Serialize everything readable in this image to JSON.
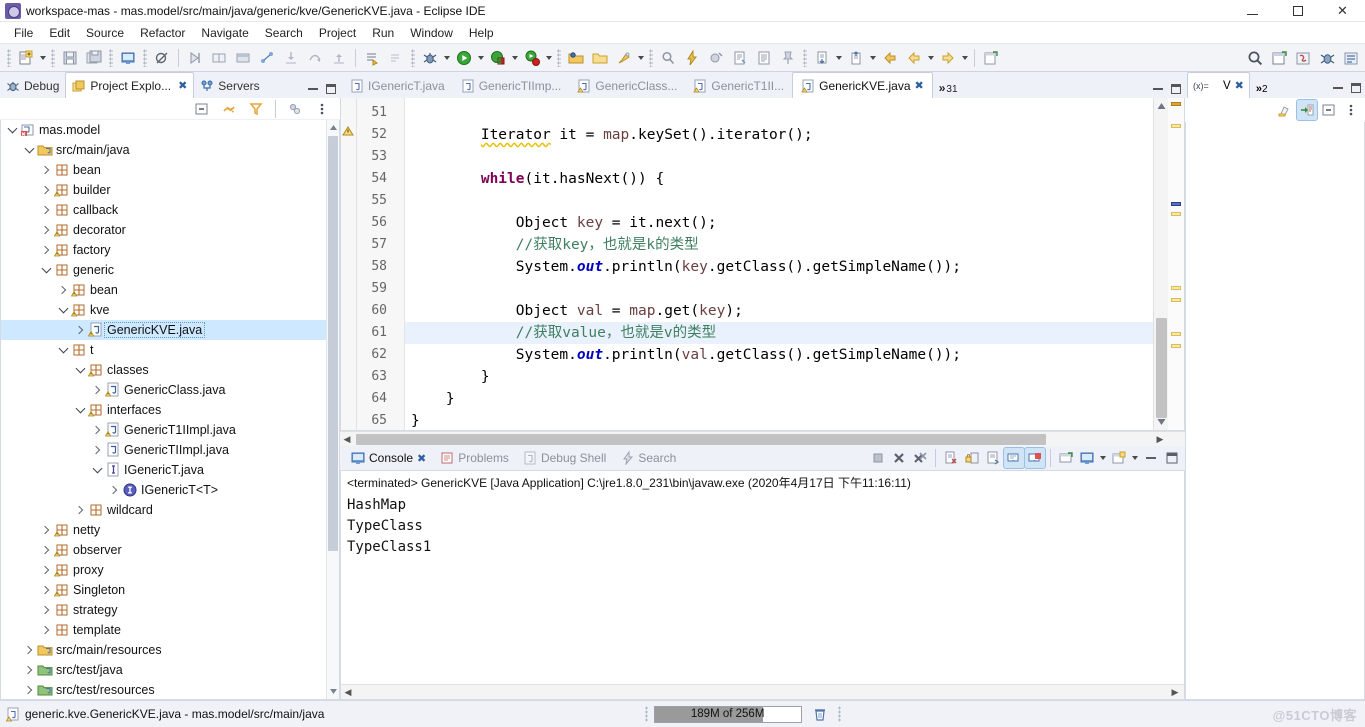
{
  "window": {
    "title": "workspace-mas - mas.model/src/main/java/generic/kve/GenericKVE.java - Eclipse IDE",
    "minimize_label": "–",
    "maximize_label": "❐",
    "close_label": "✕"
  },
  "menubar": {
    "items": [
      {
        "label": "File"
      },
      {
        "label": "Edit"
      },
      {
        "label": "Source"
      },
      {
        "label": "Refactor"
      },
      {
        "label": "Navigate"
      },
      {
        "label": "Search"
      },
      {
        "label": "Project"
      },
      {
        "label": "Run"
      },
      {
        "label": "Window"
      },
      {
        "label": "Help"
      }
    ]
  },
  "toolbar": {
    "icons": [
      "new-file-icon",
      "dropdown-arrow",
      "save-icon",
      "save-all-icon",
      "console-view-icon",
      "toggle-mark-occurrences-icon",
      "skip-breakpoints-icon",
      "new-window-icon",
      "toggle-view-icon",
      "link-icon",
      "step-icon",
      "step-alt-icon",
      "step-return-icon",
      "next-annotation-icon",
      "previous-annotation-icon",
      "debug-icon",
      "dropdown-arrow",
      "run-icon",
      "dropdown-arrow",
      "run-coverage-icon",
      "dropdown-arrow",
      "external-tools-icon",
      "dropdown-arrow",
      "new-java-project-icon",
      "open-folder-icon",
      "maven-build-icon",
      "dropdown-arrow",
      "search-refs-icon",
      "quick-access-icon",
      "new-class-icon",
      "open-type-icon",
      "open-task-icon",
      "pin-icon",
      "previous-edit-icon",
      "dropdown-arrow",
      "next-edit-icon",
      "dropdown-arrow",
      "back-icon",
      "forward-icon",
      "dropdown-arrow",
      "forward-alt-icon",
      "dropdown-arrow",
      "open-perspective-icon"
    ]
  },
  "left_panel": {
    "tabs": [
      {
        "label": "Debug",
        "icon": "debug-perspective-icon",
        "active": false,
        "closable": false
      },
      {
        "label": "Project Explo...",
        "icon": "project-explorer-icon",
        "active": true,
        "closable": true
      },
      {
        "label": "Servers",
        "icon": "servers-icon",
        "active": false,
        "closable": false
      }
    ],
    "toolbar_icons": [
      "collapse-all-icon",
      "link-with-editor-icon",
      "view-filter-icon",
      "view-layout-icon",
      "view-menu-icon"
    ],
    "tree": [
      {
        "label": "mas.model",
        "depth": 0,
        "twist": "open",
        "icon": "java-project-icon"
      },
      {
        "label": "src/main/java",
        "depth": 1,
        "twist": "open",
        "icon": "source-folder-icon"
      },
      {
        "label": "bean",
        "depth": 2,
        "twist": "closed",
        "icon": "package-icon"
      },
      {
        "label": "builder",
        "depth": 2,
        "twist": "closed",
        "icon": "package-warn-icon"
      },
      {
        "label": "callback",
        "depth": 2,
        "twist": "closed",
        "icon": "package-icon"
      },
      {
        "label": "decorator",
        "depth": 2,
        "twist": "closed",
        "icon": "package-warn-icon"
      },
      {
        "label": "factory",
        "depth": 2,
        "twist": "closed",
        "icon": "package-warn-icon"
      },
      {
        "label": "generic",
        "depth": 2,
        "twist": "open",
        "icon": "package-icon"
      },
      {
        "label": "bean",
        "depth": 3,
        "twist": "closed",
        "icon": "package-warn-icon"
      },
      {
        "label": "kve",
        "depth": 3,
        "twist": "open",
        "icon": "package-warn-icon"
      },
      {
        "label": "GenericKVE.java",
        "depth": 4,
        "twist": "closed",
        "icon": "java-file-warn-icon",
        "selected": true
      },
      {
        "label": "t",
        "depth": 3,
        "twist": "open",
        "icon": "package-icon"
      },
      {
        "label": "classes",
        "depth": 4,
        "twist": "open",
        "icon": "package-warn-icon"
      },
      {
        "label": "GenericClass.java",
        "depth": 5,
        "twist": "closed",
        "icon": "java-file-warn-icon"
      },
      {
        "label": "interfaces",
        "depth": 4,
        "twist": "open",
        "icon": "package-warn-icon"
      },
      {
        "label": "GenericT1IImpl.java",
        "depth": 5,
        "twist": "closed",
        "icon": "java-file-warn-icon"
      },
      {
        "label": "GenericTIImpl.java",
        "depth": 5,
        "twist": "closed",
        "icon": "java-file-icon"
      },
      {
        "label": "IGenericT.java",
        "depth": 5,
        "twist": "open",
        "icon": "java-interface-file-icon"
      },
      {
        "label": "IGenericT<T>",
        "depth": 6,
        "twist": "closed",
        "icon": "interface-icon"
      },
      {
        "label": "wildcard",
        "depth": 4,
        "twist": "closed",
        "icon": "package-icon"
      },
      {
        "label": "netty",
        "depth": 2,
        "twist": "closed",
        "icon": "package-warn-icon"
      },
      {
        "label": "observer",
        "depth": 2,
        "twist": "closed",
        "icon": "package-warn-icon"
      },
      {
        "label": "proxy",
        "depth": 2,
        "twist": "closed",
        "icon": "package-warn-icon"
      },
      {
        "label": "Singleton",
        "depth": 2,
        "twist": "closed",
        "icon": "package-warn-icon"
      },
      {
        "label": "strategy",
        "depth": 2,
        "twist": "closed",
        "icon": "package-icon"
      },
      {
        "label": "template",
        "depth": 2,
        "twist": "closed",
        "icon": "package-icon"
      },
      {
        "label": "src/main/resources",
        "depth": 1,
        "twist": "closed",
        "icon": "source-folder-icon"
      },
      {
        "label": "src/test/java",
        "depth": 1,
        "twist": "closed",
        "icon": "source-folder-green-icon"
      },
      {
        "label": "src/test/resources",
        "depth": 1,
        "twist": "closed",
        "icon": "source-folder-green-icon"
      }
    ]
  },
  "editor": {
    "tabs": [
      {
        "label": "IGenericT.java",
        "icon": "java-file-icon",
        "active": false,
        "closable": false
      },
      {
        "label": "GenericTIImp...",
        "icon": "java-file-icon",
        "active": false,
        "closable": false
      },
      {
        "label": "GenericClass...",
        "icon": "java-file-warn-icon",
        "active": false,
        "closable": false
      },
      {
        "label": "GenericT1II...",
        "icon": "java-file-warn-icon",
        "active": false,
        "closable": false
      },
      {
        "label": "GenericKVE.java",
        "icon": "java-file-warn-icon",
        "active": true,
        "closable": true
      }
    ],
    "more_tabs_chevron": "»",
    "more_tabs_count": "31",
    "lines": [
      {
        "num": "51",
        "tokens": []
      },
      {
        "num": "52",
        "tokens": [
          {
            "t": "        ",
            "c": ""
          },
          {
            "t": "Iterator",
            "c": "typ"
          },
          {
            "t": " it = ",
            "c": ""
          },
          {
            "t": "map",
            "c": "par"
          },
          {
            "t": ".keySet().iterator();",
            "c": ""
          }
        ]
      },
      {
        "num": "53",
        "tokens": []
      },
      {
        "num": "54",
        "tokens": [
          {
            "t": "        ",
            "c": ""
          },
          {
            "t": "while",
            "c": "kw"
          },
          {
            "t": "(it.hasNext()) {",
            "c": ""
          }
        ]
      },
      {
        "num": "55",
        "tokens": []
      },
      {
        "num": "56",
        "tokens": [
          {
            "t": "            Object ",
            "c": ""
          },
          {
            "t": "key",
            "c": "par"
          },
          {
            "t": " = it.next();",
            "c": ""
          }
        ]
      },
      {
        "num": "57",
        "tokens": [
          {
            "t": "            ",
            "c": ""
          },
          {
            "t": "//获取key，也就是k的类型",
            "c": "cm"
          }
        ]
      },
      {
        "num": "58",
        "tokens": [
          {
            "t": "            System.",
            "c": ""
          },
          {
            "t": "out",
            "c": "fld"
          },
          {
            "t": ".println(",
            "c": ""
          },
          {
            "t": "key",
            "c": "par"
          },
          {
            "t": ".getClass().getSimpleName());",
            "c": ""
          }
        ]
      },
      {
        "num": "59",
        "tokens": []
      },
      {
        "num": "60",
        "tokens": [
          {
            "t": "            Object ",
            "c": ""
          },
          {
            "t": "val",
            "c": "par"
          },
          {
            "t": " = ",
            "c": ""
          },
          {
            "t": "map",
            "c": "par"
          },
          {
            "t": ".get(",
            "c": ""
          },
          {
            "t": "key",
            "c": "par"
          },
          {
            "t": ");",
            "c": ""
          }
        ]
      },
      {
        "num": "61",
        "highlight": true,
        "tokens": [
          {
            "t": "            ",
            "c": ""
          },
          {
            "t": "//获取value，也就是v的类型",
            "c": "cm"
          }
        ]
      },
      {
        "num": "62",
        "tokens": [
          {
            "t": "            System.",
            "c": ""
          },
          {
            "t": "out",
            "c": "fld"
          },
          {
            "t": ".println(",
            "c": ""
          },
          {
            "t": "val",
            "c": "par"
          },
          {
            "t": ".getClass().getSimpleName());",
            "c": ""
          }
        ]
      },
      {
        "num": "63",
        "tokens": [
          {
            "t": "        }",
            "c": ""
          }
        ]
      },
      {
        "num": "64",
        "tokens": [
          {
            "t": "    }",
            "c": ""
          }
        ]
      },
      {
        "num": "65",
        "tokens": [
          {
            "t": "}",
            "c": ""
          }
        ]
      }
    ]
  },
  "console": {
    "tabs": [
      {
        "label": "Console",
        "icon": "console-icon",
        "active": true,
        "closable": true
      },
      {
        "label": "Problems",
        "icon": "problems-icon",
        "active": false,
        "closable": false
      },
      {
        "label": "Debug Shell",
        "icon": "debug-shell-icon",
        "active": false,
        "closable": false
      },
      {
        "label": "Search",
        "icon": "search-icon",
        "active": false,
        "closable": false
      }
    ],
    "toolbar_icons": [
      "terminate-icon",
      "remove-launch-icon",
      "remove-all-launches-icon",
      "clear-console-icon",
      "scroll-lock-icon",
      "word-wrap-icon",
      "show-console-icon",
      "pin-console-icon",
      "open-console-icon",
      "display-selected-console-icon",
      "dropdown-arrow",
      "new-console-view-icon",
      "dropdown-arrow",
      "minimize-icon",
      "maximize-icon"
    ],
    "launch_line": "<terminated> GenericKVE [Java Application] C:\\jre1.8.0_231\\bin\\javaw.exe (2020年4月17日 下午11:16:11)",
    "output": [
      "HashMap",
      "TypeClass",
      "TypeClass1"
    ]
  },
  "right_panel": {
    "tabs": [
      {
        "label": "V",
        "icon": "variables-icon",
        "active": true,
        "closable": true
      }
    ],
    "more_chevron": "»",
    "more_count": "2",
    "toolbar_icons": [
      "focus-on-active-task-icon",
      "link-with-editor-icon",
      "collapse-all-icon",
      "view-menu-icon"
    ]
  },
  "statusbar": {
    "file_icon": "java-file-warn-icon",
    "file_label": "generic.kve.GenericKVE.java - mas.model/src/main/java",
    "heap_label": "189M of 256M",
    "heap_percent": 74,
    "trash_icon": "trash-icon",
    "watermark": "@51CTO博客"
  },
  "colors": {
    "accent": "#2f5f9e",
    "selection": "#cde8ff",
    "line_highlight": "#e8f1fc",
    "keyword": "#7f0055",
    "comment": "#3f7f5f",
    "field": "#0000c0",
    "param": "#6a3e3e",
    "toolbar_bg": "#f3f4f8"
  }
}
